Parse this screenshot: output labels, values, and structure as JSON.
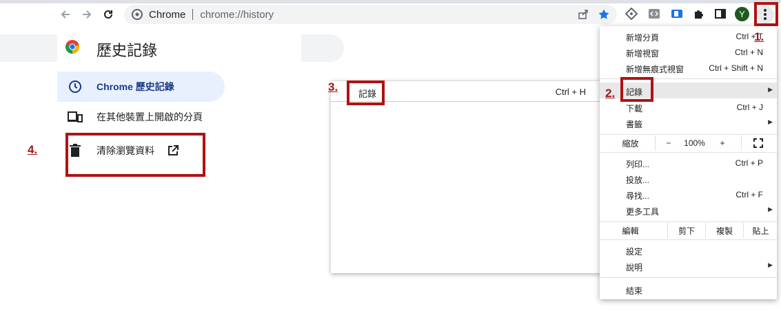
{
  "toolbar": {
    "site_name": "Chrome",
    "url": "chrome://history",
    "avatar_letter": "Y"
  },
  "history_page": {
    "title": "歷史記錄",
    "sidebar": [
      {
        "label": "Chrome 歷史記錄",
        "icon": "clock-icon",
        "active": true
      },
      {
        "label": "在其他裝置上開啟的分頁",
        "icon": "devices-icon",
        "active": false
      },
      {
        "label": "清除瀏覽資料",
        "icon": "trash-icon",
        "active": false
      }
    ]
  },
  "submenu": {
    "item_label": "記錄",
    "item_shortcut": "Ctrl + H"
  },
  "menu": {
    "new_tab": {
      "label": "新增分頁",
      "shortcut": "Ctrl + T"
    },
    "new_window": {
      "label": "新增視窗",
      "shortcut": "Ctrl + N"
    },
    "incognito": {
      "label": "新增無痕式視窗",
      "shortcut": "Ctrl + Shift + N"
    },
    "history": {
      "label": "記錄"
    },
    "downloads": {
      "label": "下載",
      "shortcut": "Ctrl + J"
    },
    "bookmarks": {
      "label": "書籤"
    },
    "zoom": {
      "label": "縮放",
      "minus": "−",
      "value": "100%",
      "plus": "+"
    },
    "print": {
      "label": "列印...",
      "shortcut": "Ctrl + P"
    },
    "cast": {
      "label": "投放..."
    },
    "find": {
      "label": "尋找...",
      "shortcut": "Ctrl + F"
    },
    "more_tools": {
      "label": "更多工具"
    },
    "edit": {
      "label": "編輯",
      "cut": "剪下",
      "copy": "複製",
      "paste": "貼上"
    },
    "settings": {
      "label": "設定"
    },
    "help": {
      "label": "說明"
    },
    "exit": {
      "label": "結束"
    }
  },
  "annotations": {
    "step1": "1.",
    "step2": "2.",
    "step3": "3.",
    "step4": "4."
  },
  "colors": {
    "annotation_red": "#b11111",
    "active_sidebar_bg": "#e8f0fe",
    "star_blue": "#1a73e8"
  }
}
